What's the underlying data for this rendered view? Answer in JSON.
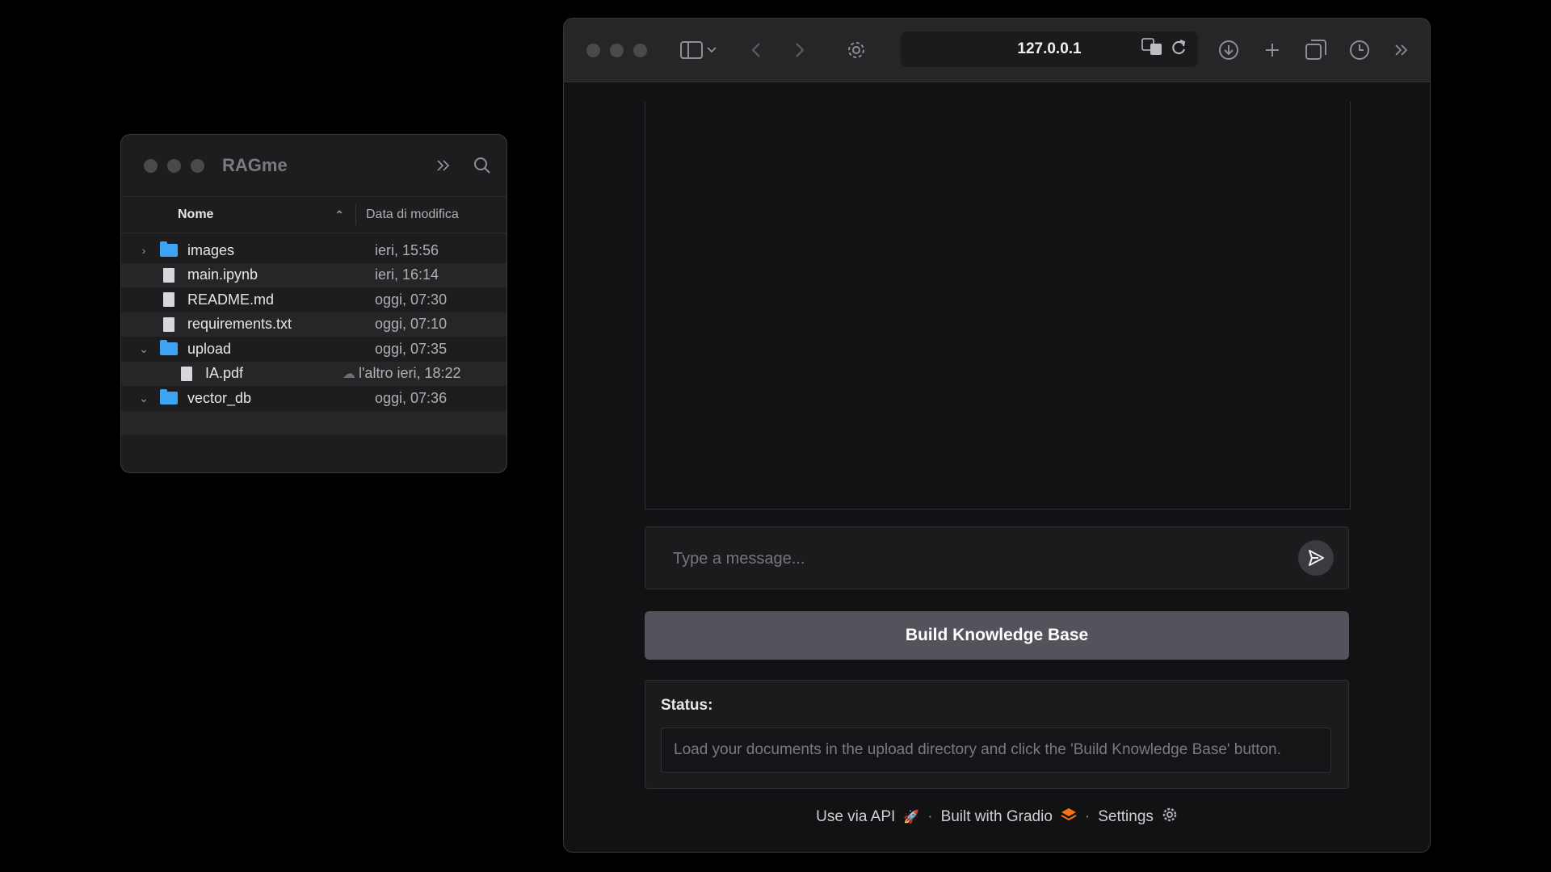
{
  "finder": {
    "title": "RAGme",
    "columns": {
      "name": "Nome",
      "modified": "Data di modifica"
    },
    "rows": [
      {
        "name": "images",
        "date": "ieri, 15:56",
        "type": "folder",
        "disclosure": "›"
      },
      {
        "name": "main.ipynb",
        "date": "ieri, 16:14",
        "type": "file",
        "disclosure": ""
      },
      {
        "name": "README.md",
        "date": "oggi, 07:30",
        "type": "file",
        "disclosure": ""
      },
      {
        "name": "requirements.txt",
        "date": "oggi, 07:10",
        "type": "file",
        "disclosure": ""
      },
      {
        "name": "upload",
        "date": "oggi, 07:35",
        "type": "folder",
        "disclosure": "⌄"
      },
      {
        "name": "IA.pdf",
        "date": "l'altro ieri, 18:22",
        "type": "file",
        "disclosure": ""
      },
      {
        "name": "vector_db",
        "date": "oggi, 07:36",
        "type": "folder",
        "disclosure": "⌄"
      }
    ]
  },
  "browser": {
    "url": "127.0.0.1"
  },
  "chat": {
    "placeholder": "Type a message..."
  },
  "build_button": {
    "label": "Build Knowledge Base"
  },
  "status": {
    "label": "Status:",
    "text": "Load your documents in the upload directory and click the 'Build Knowledge Base' button."
  },
  "footer": {
    "api": "Use via API",
    "gradio": "Built with Gradio",
    "settings": "Settings",
    "separator": "·"
  }
}
